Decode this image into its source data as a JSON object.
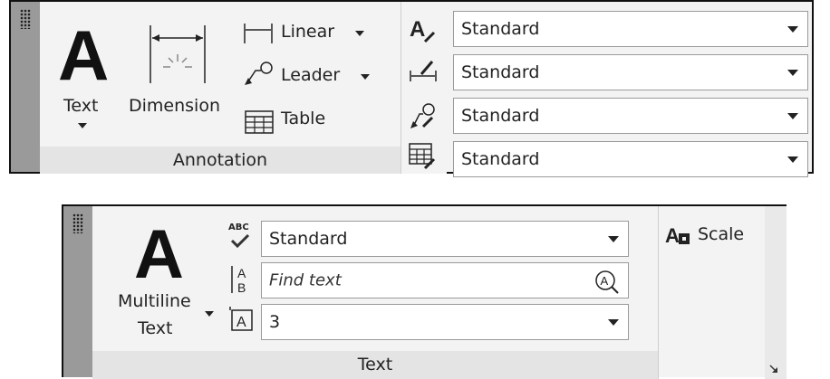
{
  "annotation_panel": {
    "text_button": "Text",
    "dimension_button": "Dimension",
    "linear_button": "Linear",
    "leader_button": "Leader",
    "table_button": "Table",
    "footer": "Annotation",
    "style_combos": [
      {
        "icon": "text-style-icon",
        "value": "Standard"
      },
      {
        "icon": "dimension-style-icon",
        "value": "Standard"
      },
      {
        "icon": "multileader-style-icon",
        "value": "Standard"
      },
      {
        "icon": "table-style-icon",
        "value": "Standard"
      }
    ]
  },
  "text_panel": {
    "multiline_line1": "Multiline",
    "multiline_line2": "Text",
    "style_combo": "Standard",
    "find_placeholder": "Find text",
    "height_combo": "3",
    "scale_button": "Scale",
    "footer": "Text",
    "spell_icon_text": "ABC"
  }
}
